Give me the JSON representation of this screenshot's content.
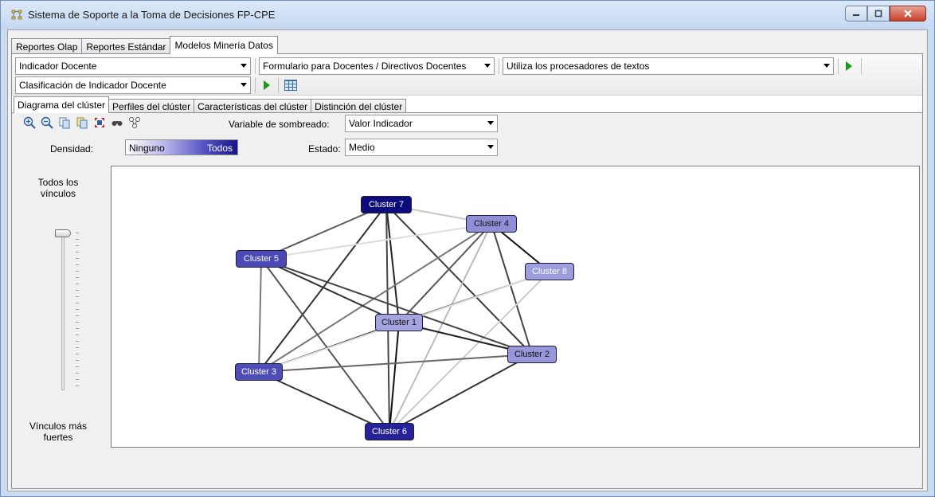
{
  "window": {
    "title": "Sistema de Soporte a la Toma de Decisiones FP-CPE",
    "controls": [
      "minimize-icon",
      "maximize-icon",
      "close-icon"
    ]
  },
  "main_tabs": [
    {
      "label": "Reportes Olap",
      "active": false
    },
    {
      "label": "Reportes Estándar",
      "active": false
    },
    {
      "label": "Modelos Minería Datos",
      "active": true
    }
  ],
  "toolbar": {
    "combo1": "Indicador Docente",
    "combo2": "Formulario para Docentes / Directivos Docentes",
    "combo3": "Utiliza los procesadores de textos",
    "combo4": "Clasificación de Indicador Docente"
  },
  "sub_tabs": [
    {
      "label": "Diagrama del clúster",
      "active": true
    },
    {
      "label": "Perfiles del clúster",
      "active": false
    },
    {
      "label": "Características del clúster",
      "active": false
    },
    {
      "label": "Distinción del clúster",
      "active": false
    }
  ],
  "controls": {
    "shading_label": "Variable de sombreado:",
    "shading_value": "Valor Indicador",
    "state_label": "Estado:",
    "state_value": "Medio",
    "density_label": "Densidad:",
    "density_low": "Ninguno",
    "density_high": "Todos",
    "tool_icons": [
      "zoom-in-icon",
      "zoom-out-icon",
      "copy-icon",
      "copy-graph-icon",
      "fit-icon",
      "find-icon",
      "layout-icon"
    ]
  },
  "slider": {
    "top_label": "Todos los vínculos",
    "bottom_label": "Vínculos más fuertes"
  },
  "clusters": [
    {
      "id": "c7",
      "label": "Cluster 7",
      "color": "#0c0c7a",
      "text": "#ffffff"
    },
    {
      "id": "c4",
      "label": "Cluster 4",
      "color": "#8f8ed6",
      "text": "#111111"
    },
    {
      "id": "c5",
      "label": "Cluster 5",
      "color": "#4b49b5",
      "text": "#ffffff"
    },
    {
      "id": "c8",
      "label": "Cluster 8",
      "color": "#9d9cdc",
      "text": "#ffffff"
    },
    {
      "id": "c1",
      "label": "Cluster 1",
      "color": "#a5a4de",
      "text": "#111111"
    },
    {
      "id": "c2",
      "label": "Cluster 2",
      "color": "#9796d8",
      "text": "#111111"
    },
    {
      "id": "c3",
      "label": "Cluster 3",
      "color": "#4f4db8",
      "text": "#ffffff"
    },
    {
      "id": "c6",
      "label": "Cluster 6",
      "color": "#25229a",
      "text": "#ffffff"
    }
  ],
  "links": [
    {
      "a": "c7",
      "b": "c4",
      "shade": "#c8c8c8"
    },
    {
      "a": "c7",
      "b": "c5",
      "shade": "#5a5a5a"
    },
    {
      "a": "c7",
      "b": "c1",
      "shade": "#222222"
    },
    {
      "a": "c7",
      "b": "c2",
      "shade": "#3a3a3a"
    },
    {
      "a": "c7",
      "b": "c3",
      "shade": "#333333"
    },
    {
      "a": "c7",
      "b": "c6",
      "shade": "#444444"
    },
    {
      "a": "c4",
      "b": "c5",
      "shade": "#dddddd"
    },
    {
      "a": "c4",
      "b": "c8",
      "shade": "#111111"
    },
    {
      "a": "c4",
      "b": "c1",
      "shade": "#555555"
    },
    {
      "a": "c4",
      "b": "c2",
      "shade": "#444444"
    },
    {
      "a": "c4",
      "b": "c3",
      "shade": "#777777"
    },
    {
      "a": "c4",
      "b": "c6",
      "shade": "#bbbbbb"
    },
    {
      "a": "c8",
      "b": "c1",
      "shade": "#777777"
    },
    {
      "a": "c8",
      "b": "c6",
      "shade": "#cccccc"
    },
    {
      "a": "c5",
      "b": "c1",
      "shade": "#333333"
    },
    {
      "a": "c5",
      "b": "c2",
      "shade": "#444444"
    },
    {
      "a": "c5",
      "b": "c3",
      "shade": "#777777"
    },
    {
      "a": "c5",
      "b": "c6",
      "shade": "#555555"
    },
    {
      "a": "c1",
      "b": "c2",
      "shade": "#222222"
    },
    {
      "a": "c1",
      "b": "c3",
      "shade": "#222222"
    },
    {
      "a": "c1",
      "b": "c6",
      "shade": "#111111"
    },
    {
      "a": "c2",
      "b": "c3",
      "shade": "#666666"
    },
    {
      "a": "c2",
      "b": "c6",
      "shade": "#333333"
    },
    {
      "a": "c3",
      "b": "c6",
      "shade": "#333333"
    },
    {
      "a": "c3",
      "b": "c8",
      "shade": "#dddddd"
    }
  ]
}
